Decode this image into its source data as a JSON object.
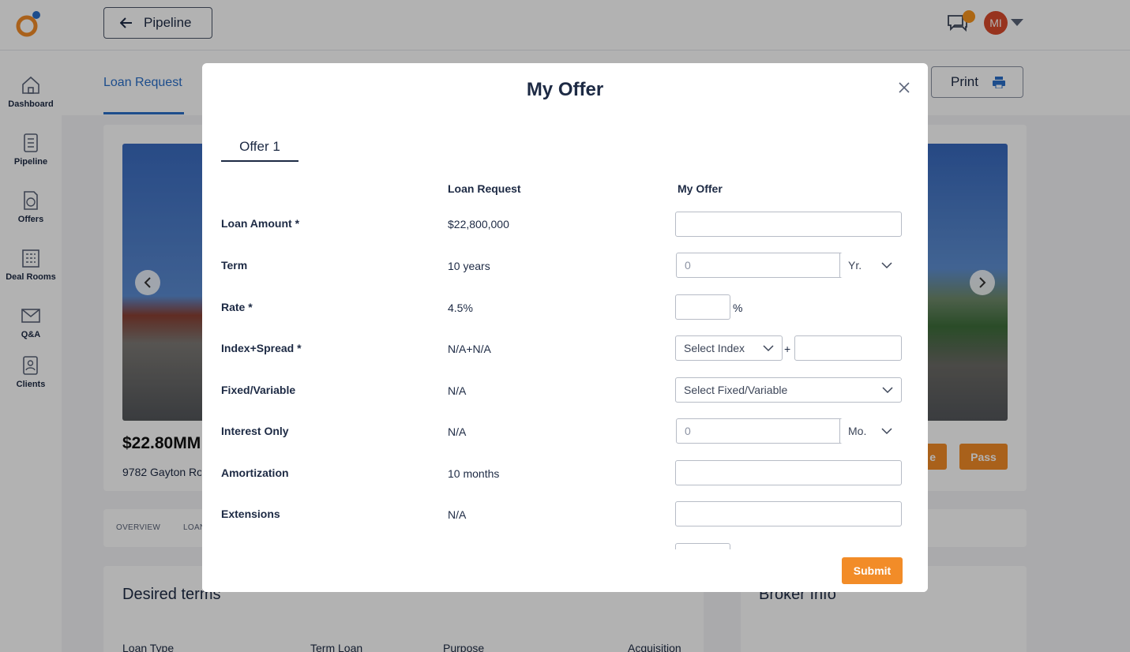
{
  "topbar": {
    "back_label": "Pipeline",
    "avatar_initials": "MI",
    "accent_color": "#f28c28"
  },
  "sidebar": {
    "items": [
      {
        "label": "Dashboard",
        "icon": "home-icon"
      },
      {
        "label": "Pipeline",
        "icon": "checklist-icon"
      },
      {
        "label": "Offers",
        "icon": "dollar-doc-icon"
      },
      {
        "label": "Deal Rooms",
        "icon": "building-icon"
      },
      {
        "label": "Q&A",
        "icon": "envelope-icon"
      },
      {
        "label": "Clients",
        "icon": "contact-icon"
      }
    ]
  },
  "page": {
    "active_tab": "Loan Request",
    "print_label": "Print",
    "price": "$22.80MM",
    "address": "9782 Gayton Ro",
    "button_partial": "e",
    "pass_label": "Pass",
    "section_tabs": [
      "OVERVIEW",
      "LOAN"
    ],
    "desired_terms_title": "Desired terms",
    "broker_info_title": "Broker Info",
    "terms_preview": {
      "loan_type_label": "Loan Type",
      "loan_type_value": "Term Loan",
      "purpose_label": "Purpose",
      "purpose_value": "Acquisition"
    }
  },
  "modal": {
    "title": "My Offer",
    "offer_tab": "Offer 1",
    "col_loan_request": "Loan Request",
    "col_my_offer": "My Offer",
    "rows": [
      {
        "label": "Loan Amount *",
        "request": "$22,800,000",
        "value": ""
      },
      {
        "label": "Term",
        "request": "10 years",
        "placeholder": "0",
        "unit": "Yr."
      },
      {
        "label": "Rate *",
        "request": "4.5%",
        "value": "",
        "suffix": "%"
      },
      {
        "label": "Index+Spread *",
        "request": "N/A+N/A",
        "select": "Select Index",
        "plus": "+"
      },
      {
        "label": "Fixed/Variable",
        "request": "N/A",
        "select": "Select Fixed/Variable"
      },
      {
        "label": "Interest Only",
        "request": "N/A",
        "placeholder": "0",
        "unit": "Mo."
      },
      {
        "label": "Amortization",
        "request": "10 months",
        "value": ""
      },
      {
        "label": "Extensions",
        "request": "N/A",
        "value": ""
      }
    ],
    "submit_label": "Submit"
  }
}
